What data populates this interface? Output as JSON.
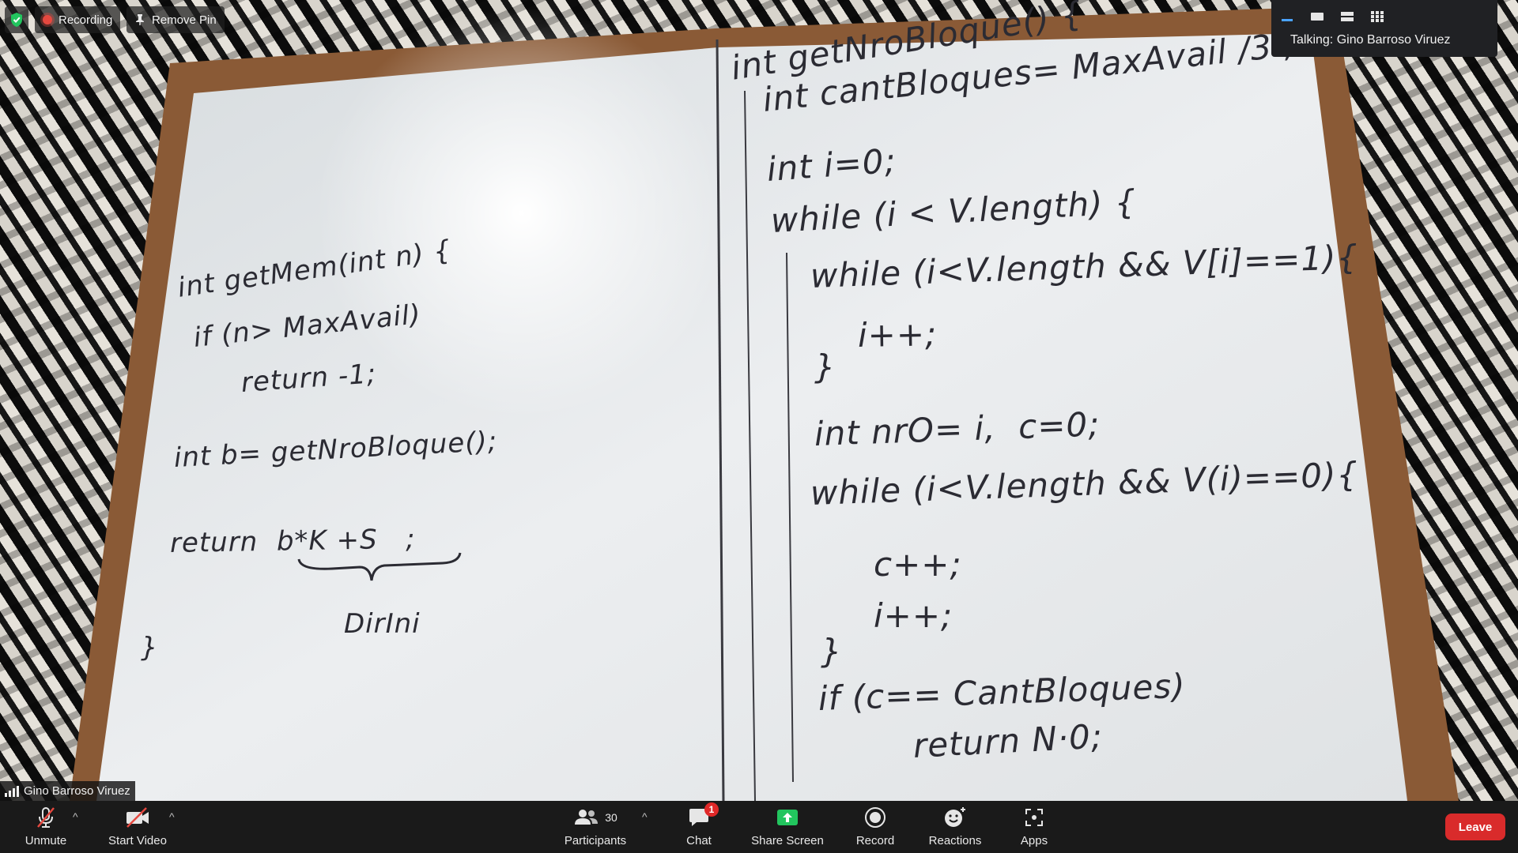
{
  "top_bar": {
    "recording_label": "Recording",
    "remove_pin_label": "Remove Pin"
  },
  "view_panel": {
    "talking_text": "Talking: Gino Barroso Viruez"
  },
  "name_tag": {
    "name": "Gino Barroso Viruez"
  },
  "toolbar": {
    "unmute_label": "Unmute",
    "start_video_label": "Start Video",
    "participants_label": "Participants",
    "participants_count": "30",
    "chat_label": "Chat",
    "chat_badge": "1",
    "share_screen_label": "Share Screen",
    "record_label": "Record",
    "reactions_label": "Reactions",
    "apps_label": "Apps",
    "leave_label": "Leave"
  },
  "whiteboard": {
    "left_lines": [
      "int getMem(int n) {",
      "if (n> MaxAvail)",
      "return -1;",
      "int b= getNroBloque();",
      "return  b*K +S   ;",
      "DirIni",
      "}"
    ],
    "right_lines": [
      "int getNroBloque() {",
      "int cantBloques= MaxAvail /3 ;",
      "int i=0;",
      "while (i < V.length) {",
      "while (i<V.length && V[i]==1){",
      "i++;",
      "}",
      "int nrO= i,  c=0;",
      "while (i<V.length && V(i)==0){",
      "c++;",
      "i++;",
      "}",
      "if (c== CantBloques)",
      "return N·0;"
    ]
  },
  "colors": {
    "toolbar_bg": "#1a1a1a",
    "share_green": "#22c55e",
    "leave_red": "#d92b2b",
    "badge_red": "#e02828",
    "board_frame": "#8a5a36",
    "board_surface": "#e9ebec"
  }
}
